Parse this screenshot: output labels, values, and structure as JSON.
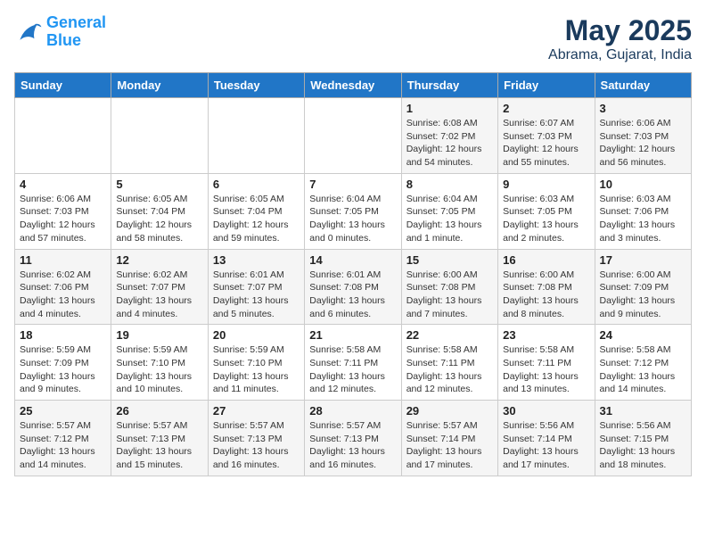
{
  "logo": {
    "line1": "General",
    "line2": "Blue"
  },
  "title": "May 2025",
  "subtitle": "Abrama, Gujarat, India",
  "days_of_week": [
    "Sunday",
    "Monday",
    "Tuesday",
    "Wednesday",
    "Thursday",
    "Friday",
    "Saturday"
  ],
  "weeks": [
    [
      {
        "day": "",
        "info": ""
      },
      {
        "day": "",
        "info": ""
      },
      {
        "day": "",
        "info": ""
      },
      {
        "day": "",
        "info": ""
      },
      {
        "day": "1",
        "info": "Sunrise: 6:08 AM\nSunset: 7:02 PM\nDaylight: 12 hours\nand 54 minutes."
      },
      {
        "day": "2",
        "info": "Sunrise: 6:07 AM\nSunset: 7:03 PM\nDaylight: 12 hours\nand 55 minutes."
      },
      {
        "day": "3",
        "info": "Sunrise: 6:06 AM\nSunset: 7:03 PM\nDaylight: 12 hours\nand 56 minutes."
      }
    ],
    [
      {
        "day": "4",
        "info": "Sunrise: 6:06 AM\nSunset: 7:03 PM\nDaylight: 12 hours\nand 57 minutes."
      },
      {
        "day": "5",
        "info": "Sunrise: 6:05 AM\nSunset: 7:04 PM\nDaylight: 12 hours\nand 58 minutes."
      },
      {
        "day": "6",
        "info": "Sunrise: 6:05 AM\nSunset: 7:04 PM\nDaylight: 12 hours\nand 59 minutes."
      },
      {
        "day": "7",
        "info": "Sunrise: 6:04 AM\nSunset: 7:05 PM\nDaylight: 13 hours\nand 0 minutes."
      },
      {
        "day": "8",
        "info": "Sunrise: 6:04 AM\nSunset: 7:05 PM\nDaylight: 13 hours\nand 1 minute."
      },
      {
        "day": "9",
        "info": "Sunrise: 6:03 AM\nSunset: 7:05 PM\nDaylight: 13 hours\nand 2 minutes."
      },
      {
        "day": "10",
        "info": "Sunrise: 6:03 AM\nSunset: 7:06 PM\nDaylight: 13 hours\nand 3 minutes."
      }
    ],
    [
      {
        "day": "11",
        "info": "Sunrise: 6:02 AM\nSunset: 7:06 PM\nDaylight: 13 hours\nand 4 minutes."
      },
      {
        "day": "12",
        "info": "Sunrise: 6:02 AM\nSunset: 7:07 PM\nDaylight: 13 hours\nand 4 minutes."
      },
      {
        "day": "13",
        "info": "Sunrise: 6:01 AM\nSunset: 7:07 PM\nDaylight: 13 hours\nand 5 minutes."
      },
      {
        "day": "14",
        "info": "Sunrise: 6:01 AM\nSunset: 7:08 PM\nDaylight: 13 hours\nand 6 minutes."
      },
      {
        "day": "15",
        "info": "Sunrise: 6:00 AM\nSunset: 7:08 PM\nDaylight: 13 hours\nand 7 minutes."
      },
      {
        "day": "16",
        "info": "Sunrise: 6:00 AM\nSunset: 7:08 PM\nDaylight: 13 hours\nand 8 minutes."
      },
      {
        "day": "17",
        "info": "Sunrise: 6:00 AM\nSunset: 7:09 PM\nDaylight: 13 hours\nand 9 minutes."
      }
    ],
    [
      {
        "day": "18",
        "info": "Sunrise: 5:59 AM\nSunset: 7:09 PM\nDaylight: 13 hours\nand 9 minutes."
      },
      {
        "day": "19",
        "info": "Sunrise: 5:59 AM\nSunset: 7:10 PM\nDaylight: 13 hours\nand 10 minutes."
      },
      {
        "day": "20",
        "info": "Sunrise: 5:59 AM\nSunset: 7:10 PM\nDaylight: 13 hours\nand 11 minutes."
      },
      {
        "day": "21",
        "info": "Sunrise: 5:58 AM\nSunset: 7:11 PM\nDaylight: 13 hours\nand 12 minutes."
      },
      {
        "day": "22",
        "info": "Sunrise: 5:58 AM\nSunset: 7:11 PM\nDaylight: 13 hours\nand 12 minutes."
      },
      {
        "day": "23",
        "info": "Sunrise: 5:58 AM\nSunset: 7:11 PM\nDaylight: 13 hours\nand 13 minutes."
      },
      {
        "day": "24",
        "info": "Sunrise: 5:58 AM\nSunset: 7:12 PM\nDaylight: 13 hours\nand 14 minutes."
      }
    ],
    [
      {
        "day": "25",
        "info": "Sunrise: 5:57 AM\nSunset: 7:12 PM\nDaylight: 13 hours\nand 14 minutes."
      },
      {
        "day": "26",
        "info": "Sunrise: 5:57 AM\nSunset: 7:13 PM\nDaylight: 13 hours\nand 15 minutes."
      },
      {
        "day": "27",
        "info": "Sunrise: 5:57 AM\nSunset: 7:13 PM\nDaylight: 13 hours\nand 16 minutes."
      },
      {
        "day": "28",
        "info": "Sunrise: 5:57 AM\nSunset: 7:13 PM\nDaylight: 13 hours\nand 16 minutes."
      },
      {
        "day": "29",
        "info": "Sunrise: 5:57 AM\nSunset: 7:14 PM\nDaylight: 13 hours\nand 17 minutes."
      },
      {
        "day": "30",
        "info": "Sunrise: 5:56 AM\nSunset: 7:14 PM\nDaylight: 13 hours\nand 17 minutes."
      },
      {
        "day": "31",
        "info": "Sunrise: 5:56 AM\nSunset: 7:15 PM\nDaylight: 13 hours\nand 18 minutes."
      }
    ]
  ]
}
